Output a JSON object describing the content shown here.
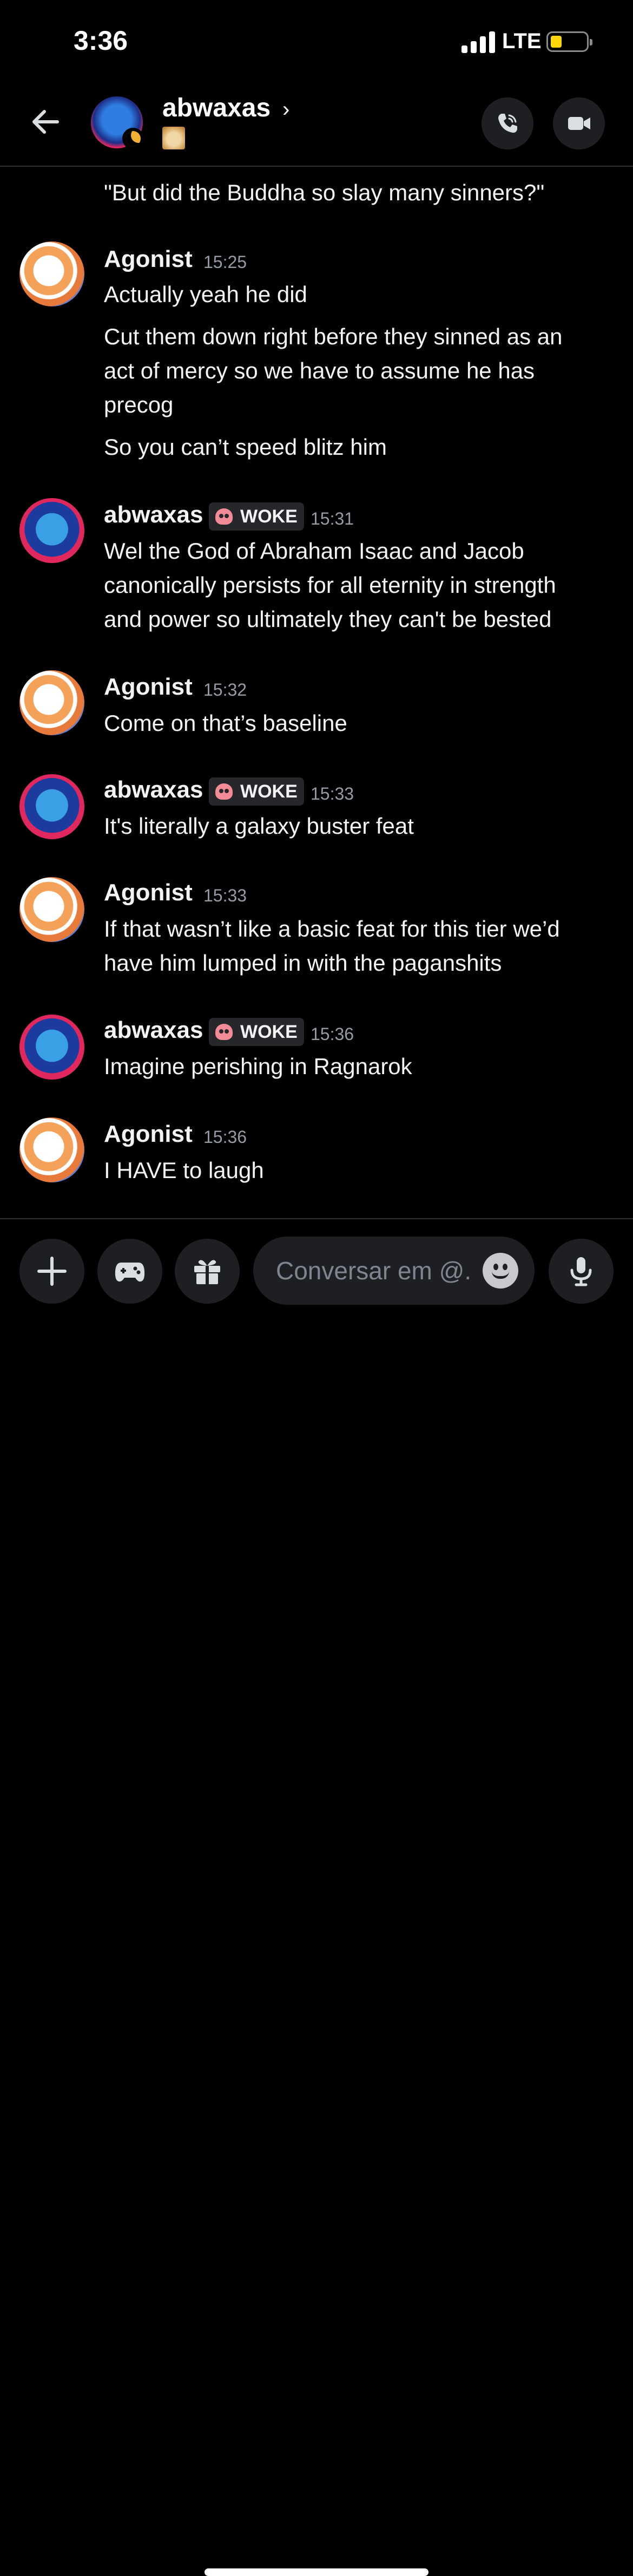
{
  "status_bar": {
    "time": "3:36",
    "network": "LTE",
    "battery_color": "#ffd60a"
  },
  "header": {
    "title": "abwaxas",
    "chevron": "›",
    "icons": {
      "back": "arrow-left-icon",
      "call": "phone-icon",
      "video": "video-camera-icon",
      "status": "moon-idle-icon"
    }
  },
  "messages": {
    "m0": {
      "line1": "\"But did the Buddha so slay many sinners?\""
    },
    "m1": {
      "author": "Agonist",
      "time": "15:25",
      "line1": "Actually yeah he did",
      "line2": "Cut them down right before they sinned as an",
      "line3": "act of mercy so we have to assume he has",
      "line4": "precog",
      "line5": "So you can’t speed blitz him"
    },
    "m2": {
      "author": "abwaxas",
      "badge": "WOKE",
      "time": "15:31",
      "line1": "Wel the God of Abraham Isaac and Jacob",
      "line2": "canonically persists for all eternity in strength",
      "line3": "and power so ultimately they can't be bested"
    },
    "m3": {
      "author": "Agonist",
      "time": "15:32",
      "line1": "Come on that’s baseline"
    },
    "m4": {
      "author": "abwaxas",
      "badge": "WOKE",
      "time": "15:33",
      "line1": "It's literally a galaxy buster feat"
    },
    "m5": {
      "author": "Agonist",
      "time": "15:33",
      "line1": "If that wasn’t like a basic feat for this tier we’d",
      "line2": "have him lumped in with the paganshits"
    },
    "m6": {
      "author": "abwaxas",
      "badge": "WOKE",
      "time": "15:36",
      "line1": "Imagine perishing in Ragnarok"
    },
    "m7": {
      "author": "Agonist",
      "time": "15:36",
      "line1": "I HAVE to laugh"
    }
  },
  "composer": {
    "placeholder": "Conversar em @...",
    "icons": {
      "plus": "plus-icon",
      "games": "gamepad-icon",
      "gift": "gift-icon",
      "emoji": "emoji-icon",
      "mic": "microphone-icon"
    }
  }
}
